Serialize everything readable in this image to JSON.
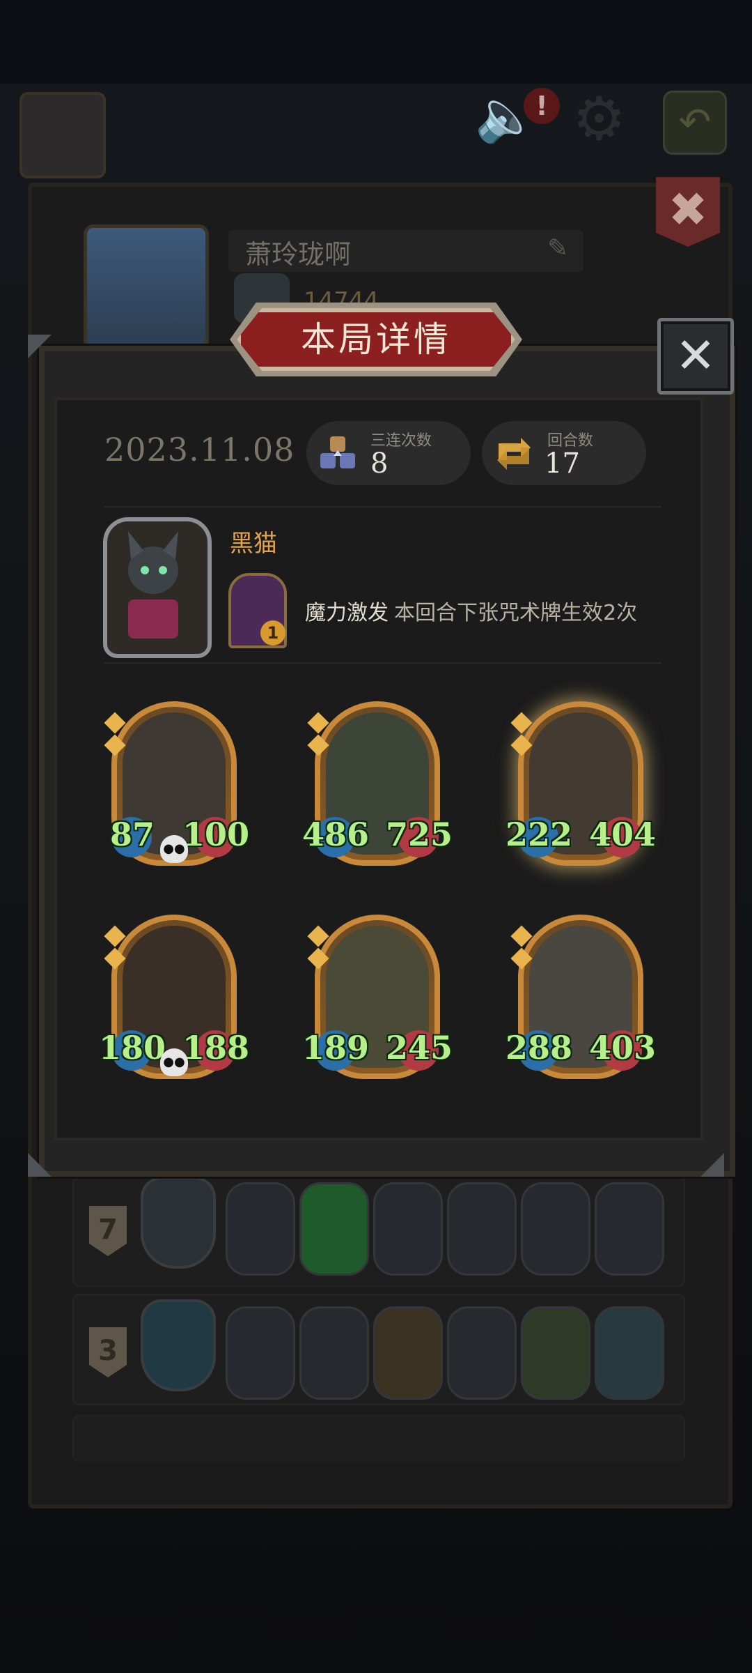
{
  "topbar": {
    "speaker_icon": "speaker-icon",
    "alert_badge": "!",
    "settings_icon": "gear-icon",
    "exit_icon": "exit-icon"
  },
  "profile": {
    "name": "萧玲珑啊",
    "score": "14744"
  },
  "popup": {
    "title": "本局详情",
    "date": "2023.11.08",
    "stats": [
      {
        "label": "三连次数",
        "value": "8",
        "icon": "triple-icon"
      },
      {
        "label": "回合数",
        "value": "17",
        "icon": "turns-icon"
      }
    ],
    "hero": {
      "name": "黑猫",
      "spell_count": "1",
      "skill_name": "魔力激发",
      "skill_desc": "本回合下张咒术牌生效2次"
    },
    "minions": [
      {
        "atk": "87",
        "hp": "100",
        "skull": true,
        "color": "#3e3a33"
      },
      {
        "atk": "486",
        "hp": "725",
        "skull": false,
        "color": "#3c4538"
      },
      {
        "atk": "222",
        "hp": "404",
        "skull": false,
        "color": "#433b32"
      },
      {
        "atk": "180",
        "hp": "188",
        "skull": true,
        "color": "#3a2f26"
      },
      {
        "atk": "189",
        "hp": "245",
        "skull": false,
        "color": "#4a4a36"
      },
      {
        "atk": "288",
        "hp": "403",
        "skull": false,
        "color": "#4a4640"
      }
    ]
  },
  "history": [
    {
      "rank": "7"
    },
    {
      "rank": "3"
    }
  ]
}
